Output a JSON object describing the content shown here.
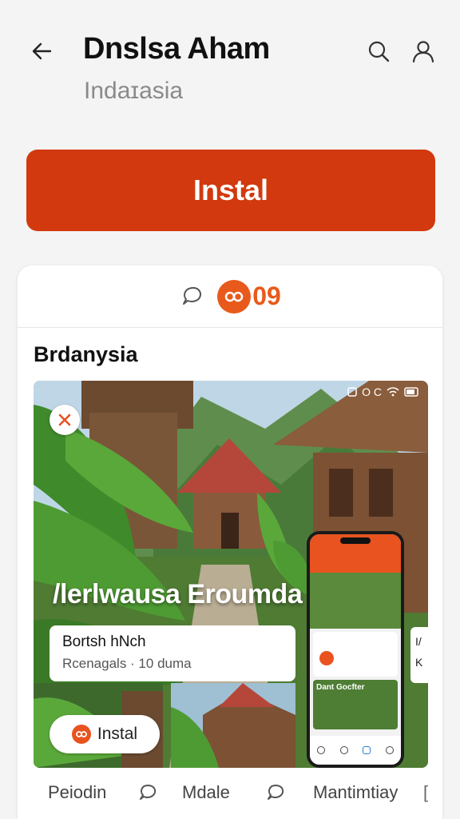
{
  "header": {
    "title": "Dnslsa Aham",
    "subtitle": "Indaɪasia",
    "back_icon": "arrow-left-icon",
    "search_icon": "search-icon",
    "profile_icon": "user-icon"
  },
  "install_button": {
    "label": "Instal",
    "color": "#d2390e"
  },
  "card": {
    "rating_text": "09",
    "rating_icon": "chat-bubble-icon",
    "section_title": "Brdanysia",
    "gallery": {
      "overlay_title": "/lerlwausa Eroumda",
      "status_text": "O C",
      "info_card": {
        "title": "Bortsh hNch",
        "subtitle": "Rcenagals · 10 duma"
      },
      "install_pill_label": "Instal",
      "phone_label": "Dant Gocfter",
      "right_partial_top": "I/",
      "right_partial_bottom": "K"
    }
  },
  "bottom_nav": {
    "items": [
      "Peiodin",
      "Mdale",
      "Mantimtiay"
    ],
    "icons": [
      "chat-icon",
      "chat-icon"
    ]
  },
  "accent_color": "#e85a1b"
}
